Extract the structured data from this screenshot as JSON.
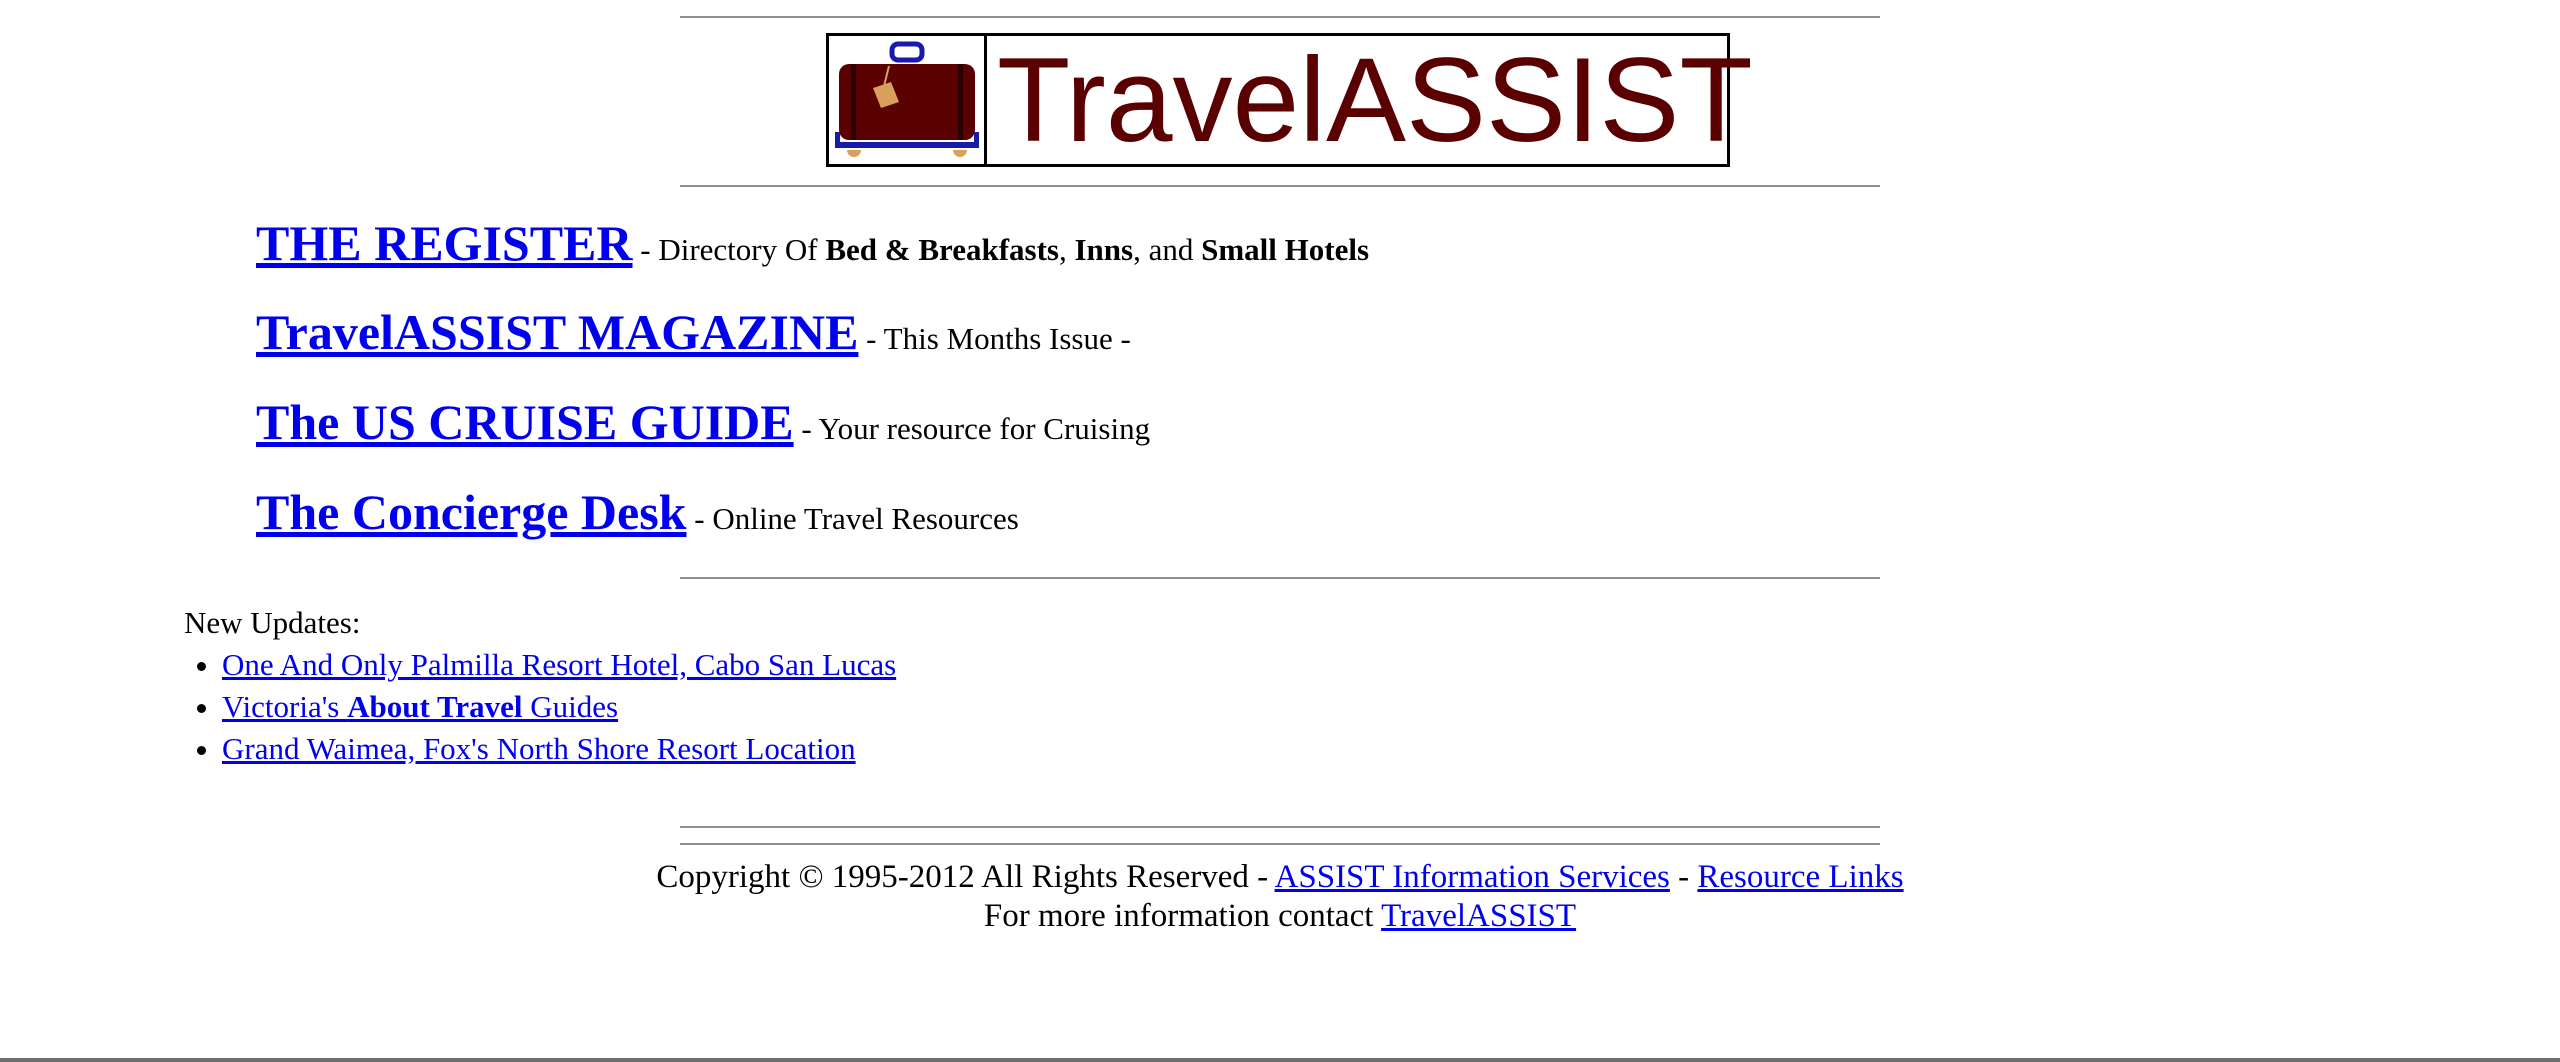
{
  "logo": {
    "text": "TravelASSIST",
    "icon": "suitcase-icon",
    "colors": {
      "logo_text": "#5a0000",
      "suitcase": "#5a0000",
      "luggage_cart": "#1a1aa8",
      "tag": "#d9a05b"
    }
  },
  "sections": [
    {
      "link": "THE REGISTER",
      "desc_prefix": " - Directory Of ",
      "b1": "Bed & Breakfasts",
      "sep1": ", ",
      "b2": "Inns",
      "sep2": ", and ",
      "b3": "Small Hotels"
    },
    {
      "link": "TravelASSIST MAGAZINE",
      "desc": " - This Months Issue -"
    },
    {
      "link": "The US CRUISE GUIDE",
      "desc": " - Your resource for Cruising"
    },
    {
      "link": "The Concierge Desk",
      "desc": " - Online Travel Resources"
    }
  ],
  "updates": {
    "heading": "New Updates:",
    "items": [
      {
        "text": "One And Only Palmilla Resort Hotel, Cabo San Lucas"
      },
      {
        "pre": "Victoria's ",
        "bold": "About Travel",
        "post": " Guides"
      },
      {
        "text": "Grand Waimea, Fox's North Shore Resort Location"
      }
    ]
  },
  "footer": {
    "copyright": "Copyright © 1995-2012 All Rights Reserved - ",
    "link1": "ASSIST Information Services",
    "sep": " - ",
    "link2": "Resource Links",
    "contact_prefix": "For more information contact ",
    "contact_link": "TravelASSIST"
  },
  "colors": {
    "link": "#0000ee",
    "rule": "#8e8e8e",
    "background": "#ffffff"
  }
}
